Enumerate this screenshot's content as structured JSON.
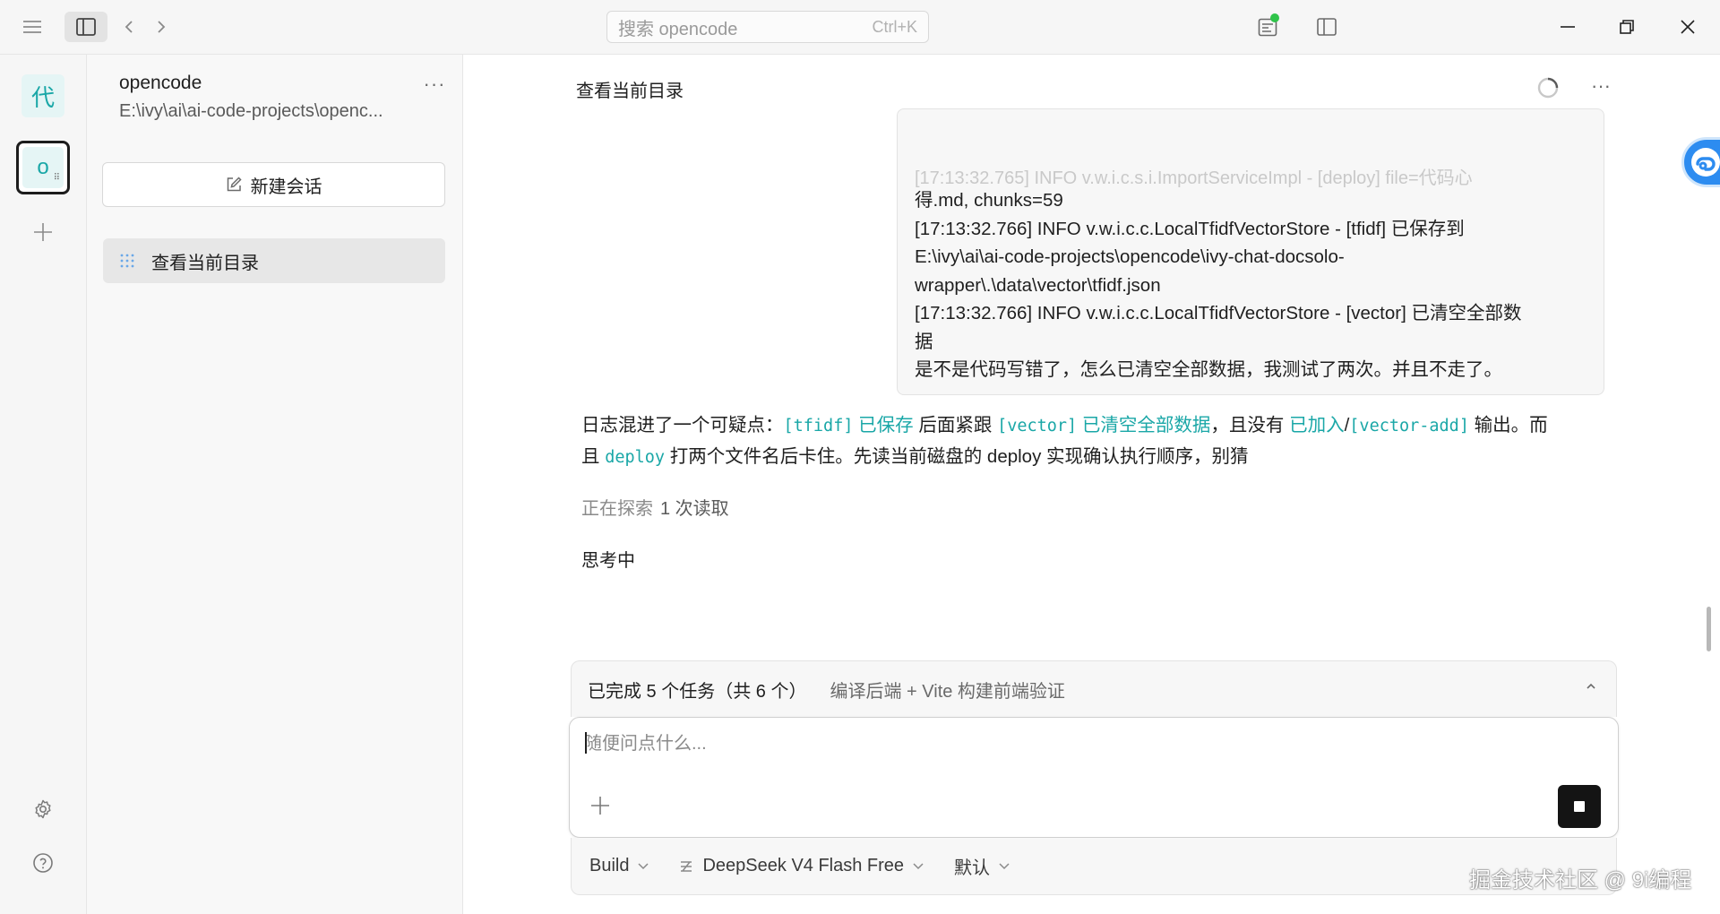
{
  "titlebar": {
    "search_placeholder": "搜索 opencode",
    "search_shortcut": "Ctrl+K"
  },
  "rail": {
    "projects": [
      {
        "label": "代"
      },
      {
        "label": "o"
      }
    ]
  },
  "sessions": {
    "project_name": "opencode",
    "project_path": "E:\\ivy\\ai\\ai-code-projects\\openc...",
    "more": "···",
    "new_session_label": "新建会话",
    "items": [
      {
        "label": "查看当前目录"
      }
    ]
  },
  "main": {
    "title": "查看当前目录",
    "more": "···",
    "user_message": {
      "faded_line": "[17:13:32.765] INFO  v.w.i.c.s.i.ImportServiceImpl - [deploy] file=代码心",
      "lines": [
        "得.md, chunks=59",
        "[17:13:32.766] INFO  v.w.i.c.c.LocalTfidfVectorStore - [tfidf] 已保存到",
        "E:\\ivy\\ai\\ai-code-projects\\opencode\\ivy-chat-docsolo-",
        "wrapper\\.\\data\\vector\\tfidf.json",
        "[17:13:32.766] INFO  v.w.i.c.c.LocalTfidfVectorStore - [vector] 已清空全部数",
        "据",
        " 是不是代码写错了，怎么已清空全部数据，我测试了两次。并且不走了。"
      ]
    },
    "assistant": {
      "p1_text1": "日志混进了一个可疑点：",
      "p1_code1": "[tfidf]",
      "p1_teal1": " 已保存 ",
      "p1_text2": "后面紧跟 ",
      "p1_code2": "[vector]",
      "p1_teal2": " 已清空全部数据",
      "p1_text3": "，且没有 ",
      "p1_teal3": "已加入",
      "p1_slash": "/",
      "p1_code3": "[vector-add]",
      "p1_text4": " 输出。而",
      "p2_text1": "且 ",
      "p2_code1": "deploy",
      "p2_text2": " 打两个文件名后卡住。先读当前磁盘的 deploy 实现确认执行顺序，别猜"
    },
    "exploring_label": "正在探索",
    "exploring_count": "1 次读取",
    "thinking_label": "思考中"
  },
  "composer": {
    "tasks_done": "已完成 5 个任务（共 6 个）",
    "tasks_current": "编译后端 + Vite 构建前端验证",
    "placeholder": "随便问点什么...",
    "agent": "Build",
    "model": "DeepSeek V4 Flash Free",
    "variant": "默认"
  },
  "watermark": "掘金技术社区 @ 9i编程",
  "colors": {
    "accent_teal": "#1aa7a7",
    "status_green": "#2fc44a",
    "stop_button": "#141414"
  },
  "icons": [
    "hamburger-icon",
    "sidebar-toggle-icon",
    "back-icon",
    "forward-icon",
    "review-icon",
    "panel-icon",
    "minimize-icon",
    "maximize-icon",
    "close-icon",
    "plus-icon",
    "settings-icon",
    "help-icon",
    "edit-icon",
    "session-icon",
    "spinner-icon",
    "chevron-up-icon",
    "stop-icon",
    "model-icon",
    "chevron-down-icon"
  ]
}
